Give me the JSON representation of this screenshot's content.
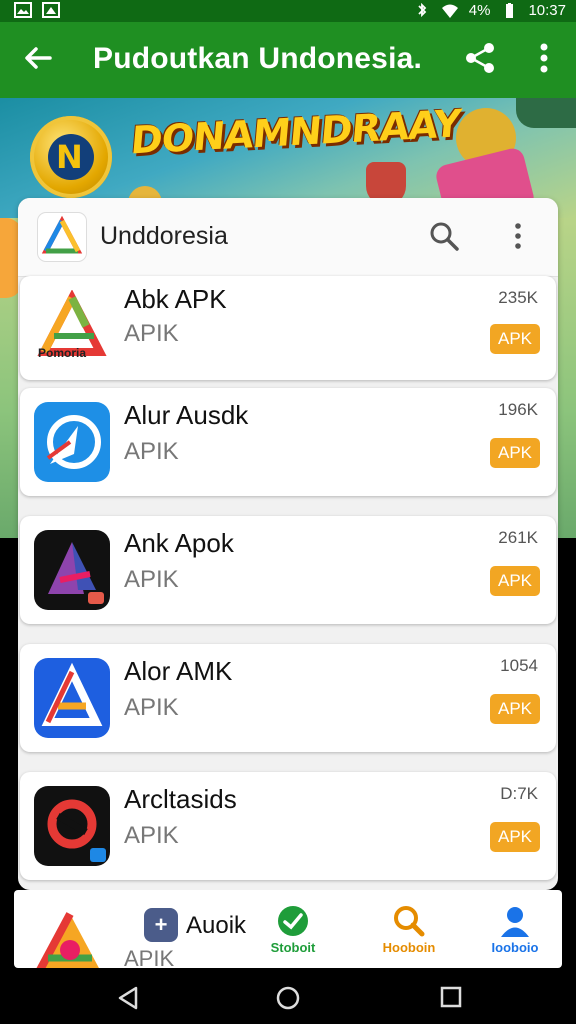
{
  "status_bar": {
    "time": "10:37",
    "battery": "4%"
  },
  "app_bar": {
    "title": "Pudoutkan Undonesia."
  },
  "banner": {
    "headline": "DONAMNDRAAY"
  },
  "search_bar": {
    "label": "Unddoresia"
  },
  "apps": [
    {
      "name": "Abk APK",
      "type": "APIK",
      "size": "235K",
      "badge": "APK"
    },
    {
      "name": "Alur Ausdk",
      "type": "APIK",
      "size": "196K",
      "badge": "APK"
    },
    {
      "name": "Ank Apok",
      "type": "APIK",
      "size": "261K",
      "badge": "APK"
    },
    {
      "name": "Alor AMK",
      "type": "APIK",
      "size": "1054",
      "badge": "APK"
    },
    {
      "name": "Arcltasids",
      "type": "APIK",
      "size": "D:7K",
      "badge": "APK"
    }
  ],
  "first_app_icon_text": "Pomoria",
  "bottom_bar": {
    "preview_name": "Auoik",
    "preview_sub": "APIK",
    "nav": [
      {
        "label": "Stoboit",
        "icon": "check-circle-icon",
        "color": "#1f9d3a"
      },
      {
        "label": "Hooboin",
        "icon": "search-icon",
        "color": "#e58c00"
      },
      {
        "label": "Iooboio",
        "icon": "person-icon",
        "color": "#1a73e8"
      }
    ]
  },
  "colors": {
    "app_bar": "#1f8f22",
    "apk_badge": "#f2a623"
  }
}
